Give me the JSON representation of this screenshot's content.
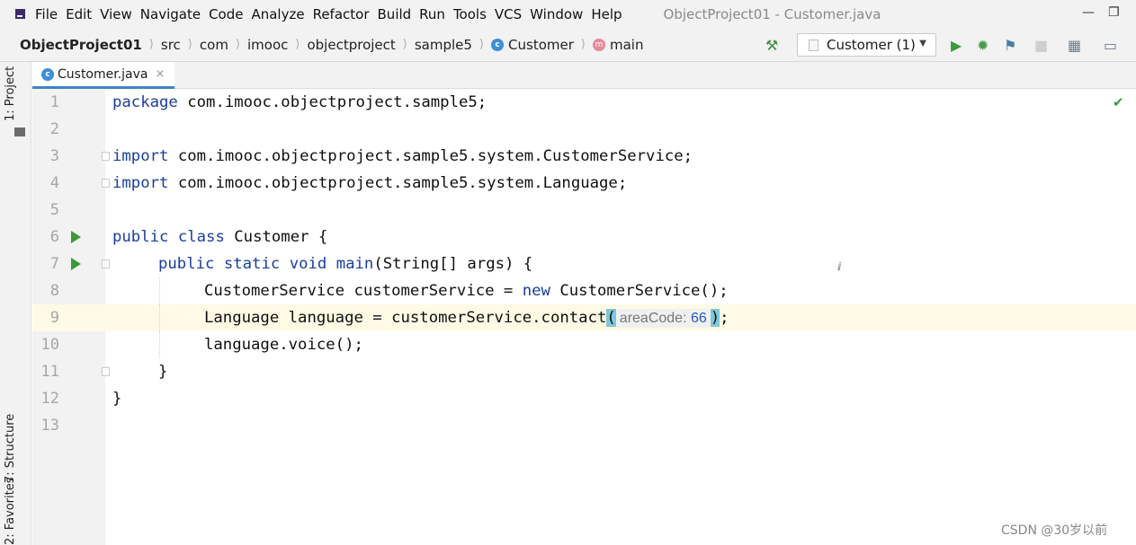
{
  "menubar": {
    "items": [
      "File",
      "Edit",
      "View",
      "Navigate",
      "Code",
      "Analyze",
      "Refactor",
      "Build",
      "Run",
      "Tools",
      "VCS",
      "Window",
      "Help"
    ],
    "title": "ObjectProject01 - Customer.java"
  },
  "breadcrumb": {
    "project": "ObjectProject01",
    "parts": [
      "src",
      "com",
      "imooc",
      "objectproject",
      "sample5"
    ],
    "class": "Customer",
    "method": "main"
  },
  "toolbar": {
    "run_config": "Customer (1)"
  },
  "toolwindows": {
    "project": "1: Project",
    "structure": "7: Structure",
    "favorites": "2: Favorites"
  },
  "editor": {
    "tab_label": "Customer.java",
    "current_line": 9,
    "lines": [
      {
        "n": "1",
        "text": "package com.imooc.objectproject.sample5;"
      },
      {
        "n": "2",
        "text": ""
      },
      {
        "n": "3",
        "text": "import com.imooc.objectproject.sample5.system.CustomerService;"
      },
      {
        "n": "4",
        "text": "import com.imooc.objectproject.sample5.system.Language;"
      },
      {
        "n": "5",
        "text": ""
      },
      {
        "n": "6",
        "text": "public class Customer {"
      },
      {
        "n": "7",
        "text": "public static void main(String[] args) {"
      },
      {
        "n": "8",
        "text": "CustomerService customerService = new CustomerService();"
      },
      {
        "n": "9",
        "text_before": "Language language = customerService.contact",
        "param_hint": "areaCode:",
        "arg_value": "66",
        "text_after": ";"
      },
      {
        "n": "10",
        "text": "language.voice();"
      },
      {
        "n": "11",
        "text": "}"
      },
      {
        "n": "12",
        "text": "}"
      },
      {
        "n": "13",
        "text": ""
      }
    ]
  },
  "watermark": "CSDN @30岁以前",
  "colors": {
    "keyword": "#1a3e9e",
    "run_icon": "#3a9a3a",
    "current_line": "#fefae5",
    "tab_underline": "#4083c9"
  }
}
